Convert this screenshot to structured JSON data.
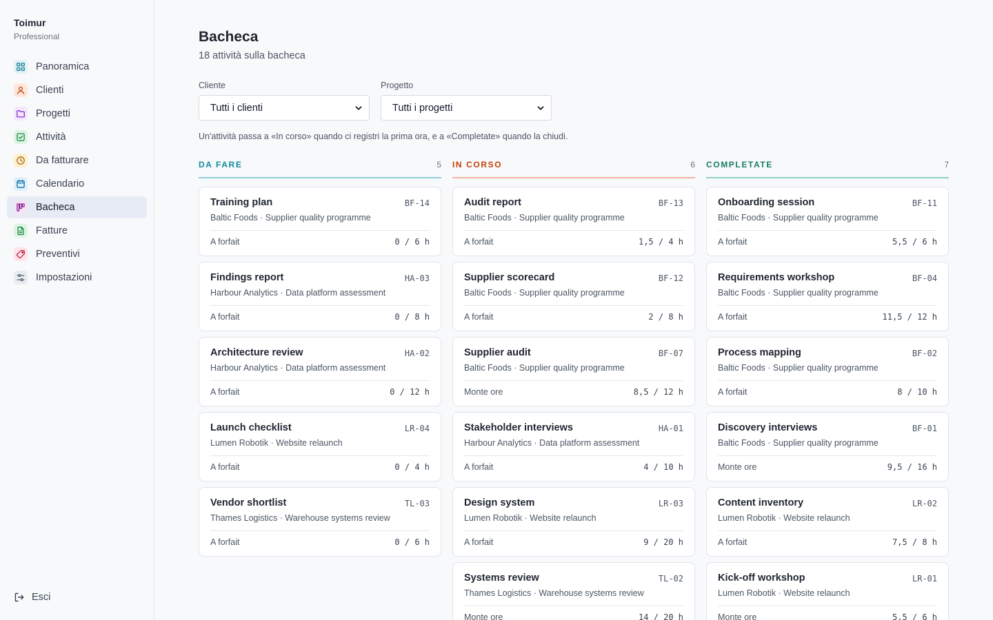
{
  "app": {
    "name": "Toimur",
    "plan": "Professional"
  },
  "sidebar": {
    "items": [
      {
        "label": "Panoramica",
        "icon": "grid-icon",
        "color": "#0e7490",
        "bg": "#e0f2f6"
      },
      {
        "label": "Clienti",
        "icon": "user-icon",
        "color": "#c2410c",
        "bg": "#fde7dc"
      },
      {
        "label": "Progetti",
        "icon": "folder-icon",
        "color": "#7e22ce",
        "bg": "#f3e8fb"
      },
      {
        "label": "Attività",
        "icon": "checkbox-icon",
        "color": "#15803d",
        "bg": "#dcf4e4"
      },
      {
        "label": "Da fatturare",
        "icon": "clock-icon",
        "color": "#a16207",
        "bg": "#fdf1cf"
      },
      {
        "label": "Calendario",
        "icon": "calendar-icon",
        "color": "#0369a1",
        "bg": "#dff0fa"
      },
      {
        "label": "Bacheca",
        "icon": "kanban-icon",
        "color": "#86198f",
        "bg": "#f5e4f5"
      },
      {
        "label": "Fatture",
        "icon": "document-icon",
        "color": "#15803d",
        "bg": "#dcf4e4"
      },
      {
        "label": "Preventivi",
        "icon": "tag-icon",
        "color": "#be123c",
        "bg": "#fde4e8"
      },
      {
        "label": "Impostazioni",
        "icon": "sliders-icon",
        "color": "#475569",
        "bg": "#e8ebf0"
      }
    ],
    "active_index": 6,
    "logout_label": "Esci"
  },
  "header": {
    "title": "Bacheca",
    "subtitle": "18 attività sulla bacheca"
  },
  "filters": {
    "client": {
      "label": "Cliente",
      "value": "Tutti i clienti"
    },
    "project": {
      "label": "Progetto",
      "value": "Tutti i progetti"
    }
  },
  "hint": "Un'attività passa a «In corso» quando ci registri la prima ora, e a «Completate» quando la chiudi.",
  "colors": {
    "todo": "#0f8aa0",
    "todo_rule": "#8fd0da",
    "doing": "#c2410c",
    "doing_rule": "#f2b3a0",
    "done": "#167f61",
    "done_rule": "#8fd3c0"
  },
  "board": {
    "todo": {
      "label": "DA FARE",
      "count": "5",
      "cards": [
        {
          "title": "Training plan",
          "code": "BF-14",
          "sub": "Baltic Foods · Supplier quality programme",
          "billing": "A forfait",
          "hours": "0 / 6 h"
        },
        {
          "title": "Findings report",
          "code": "HA-03",
          "sub": "Harbour Analytics · Data platform assessment",
          "billing": "A forfait",
          "hours": "0 / 8 h"
        },
        {
          "title": "Architecture review",
          "code": "HA-02",
          "sub": "Harbour Analytics · Data platform assessment",
          "billing": "A forfait",
          "hours": "0 / 12 h"
        },
        {
          "title": "Launch checklist",
          "code": "LR-04",
          "sub": "Lumen Robotik · Website relaunch",
          "billing": "A forfait",
          "hours": "0 / 4 h"
        },
        {
          "title": "Vendor shortlist",
          "code": "TL-03",
          "sub": "Thames Logistics · Warehouse systems review",
          "billing": "A forfait",
          "hours": "0 / 6 h"
        }
      ]
    },
    "doing": {
      "label": "IN CORSO",
      "count": "6",
      "cards": [
        {
          "title": "Audit report",
          "code": "BF-13",
          "sub": "Baltic Foods · Supplier quality programme",
          "billing": "A forfait",
          "hours": "1,5 / 4 h"
        },
        {
          "title": "Supplier scorecard",
          "code": "BF-12",
          "sub": "Baltic Foods · Supplier quality programme",
          "billing": "A forfait",
          "hours": "2 / 8 h"
        },
        {
          "title": "Supplier audit",
          "code": "BF-07",
          "sub": "Baltic Foods · Supplier quality programme",
          "billing": "Monte ore",
          "hours": "8,5 / 12 h"
        },
        {
          "title": "Stakeholder interviews",
          "code": "HA-01",
          "sub": "Harbour Analytics · Data platform assessment",
          "billing": "A forfait",
          "hours": "4 / 10 h"
        },
        {
          "title": "Design system",
          "code": "LR-03",
          "sub": "Lumen Robotik · Website relaunch",
          "billing": "A forfait",
          "hours": "9 / 20 h"
        },
        {
          "title": "Systems review",
          "code": "TL-02",
          "sub": "Thames Logistics · Warehouse systems review",
          "billing": "Monte ore",
          "hours": "14 / 20 h"
        }
      ]
    },
    "done": {
      "label": "COMPLETATE",
      "count": "7",
      "cards": [
        {
          "title": "Onboarding session",
          "code": "BF-11",
          "sub": "Baltic Foods · Supplier quality programme",
          "billing": "A forfait",
          "hours": "5,5 / 6 h"
        },
        {
          "title": "Requirements workshop",
          "code": "BF-04",
          "sub": "Baltic Foods · Supplier quality programme",
          "billing": "A forfait",
          "hours": "11,5 / 12 h"
        },
        {
          "title": "Process mapping",
          "code": "BF-02",
          "sub": "Baltic Foods · Supplier quality programme",
          "billing": "A forfait",
          "hours": "8 / 10 h"
        },
        {
          "title": "Discovery interviews",
          "code": "BF-01",
          "sub": "Baltic Foods · Supplier quality programme",
          "billing": "Monte ore",
          "hours": "9,5 / 16 h"
        },
        {
          "title": "Content inventory",
          "code": "LR-02",
          "sub": "Lumen Robotik · Website relaunch",
          "billing": "A forfait",
          "hours": "7,5 / 8 h"
        },
        {
          "title": "Kick-off workshop",
          "code": "LR-01",
          "sub": "Lumen Robotik · Website relaunch",
          "billing": "Monte ore",
          "hours": "5,5 / 6 h"
        }
      ]
    }
  }
}
